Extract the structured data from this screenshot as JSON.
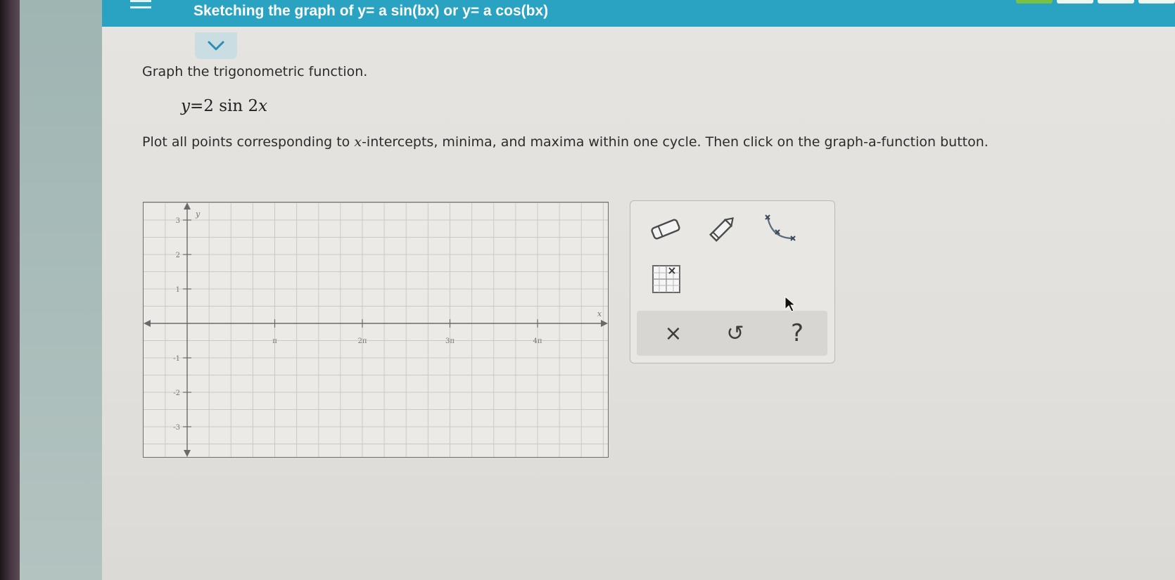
{
  "header": {
    "title": "Sketching the graph of y= a sin(bx) or y= a cos(bx)",
    "progress_segments": [
      true,
      false,
      false,
      false
    ]
  },
  "question": {
    "prompt": "Graph the trigonometric function.",
    "equation": {
      "lhs": "y",
      "eq": "=",
      "rhs": "2 sin 2",
      "var": "x"
    },
    "instruction_before": "Plot all points corresponding to ",
    "instruction_var": "x",
    "instruction_after": "-intercepts, minima, and maxima within one cycle. Then click on the graph-a-function button."
  },
  "graph": {
    "x_axis_label": "x",
    "y_axis_label": "y",
    "x_tick_labels": [
      "π",
      "2π",
      "3π",
      "4π"
    ],
    "y_tick_labels": [
      "3",
      "2",
      "1",
      "-1",
      "-2",
      "-3"
    ]
  },
  "tools": {
    "eraser_icon": "eraser-icon",
    "pencil_icon": "pencil-icon",
    "curve_icon": "curve-icon",
    "graph_function_icon": "graph-function-icon"
  },
  "actions": {
    "clear": "×",
    "undo": "↺",
    "help": "?"
  },
  "colors": {
    "header": "#2aa3c3",
    "grid": "#c9c9c9",
    "axis": "#6a6a6a"
  }
}
